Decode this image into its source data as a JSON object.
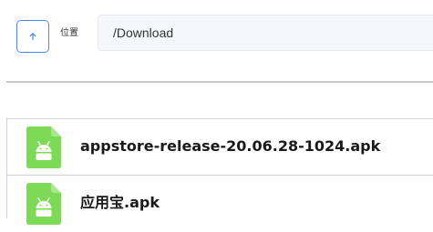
{
  "toolbar": {
    "up_icon": "arrow-up-icon",
    "location_label": "位置",
    "path_value": "/Download"
  },
  "files": [
    {
      "name": "appstore-release-20.06.28-1024.apk",
      "icon": "android-apk-file-icon"
    },
    {
      "name": "应用宝.apk",
      "icon": "android-apk-file-icon"
    }
  ],
  "colors": {
    "accent": "#4f86f7",
    "apk_icon": "#7ed957",
    "path_field_bg": "#f5f7fa",
    "divider": "#c9c9c9",
    "row_border": "#d0d0d0"
  }
}
